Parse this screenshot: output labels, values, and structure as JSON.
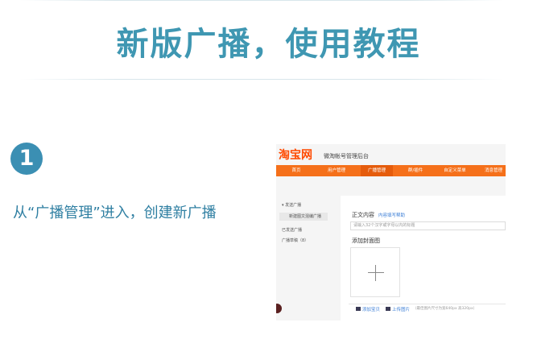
{
  "header": {
    "title": "新版广播，使用教程"
  },
  "step": {
    "number": "1",
    "text": "从“广播管理”进入，创建新广播"
  },
  "screenshot": {
    "logo": "淘宝网",
    "subtitle": "微淘帐号管理后台",
    "nav": [
      "首页",
      "用户管理",
      "广播管理",
      "群/插件",
      "自定义菜单",
      "消息管理"
    ],
    "active_nav": "广播管理",
    "sidebar": {
      "group": "▾ 发送广播",
      "items": [
        "新建图文混编广播",
        "已发送广播",
        "广播草稿（8）"
      ]
    },
    "content": {
      "body_label": "正文内容",
      "body_link": "内容填写帮助",
      "input_placeholder": "请输入32个汉字或字母以内的标题",
      "cover_label": "添加封面图",
      "add_item_label": "添加宝贝",
      "upload_label": "上传图片",
      "upload_hint": "（最佳图片尺寸为宽640px 高320px）"
    }
  },
  "colors": {
    "title": "#3f97b2",
    "badge": "#3b8fb3",
    "nav": "#f5701a",
    "logo": "#ff4a00"
  }
}
